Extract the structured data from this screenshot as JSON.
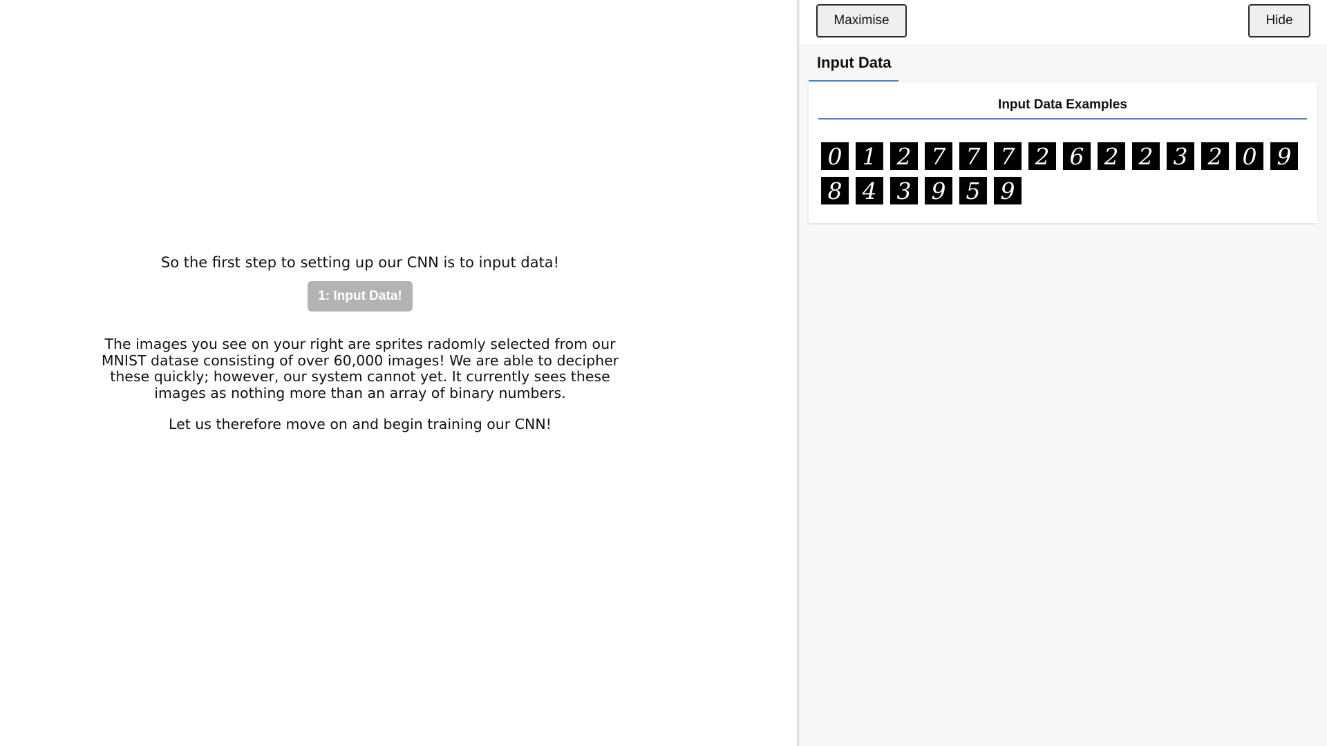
{
  "left": {
    "intro": "So the first step to setting up our CNN is to input data!",
    "step_button": "1: Input Data!",
    "description": "The images you see on your right are sprites radomly selected from our MNIST datase consisting of over 60,000 images! We are able to decipher these quickly; however, our system cannot yet. It currently sees these images as nothing more than an array of binary numbers.",
    "closing": "Let us therefore move on and begin training our CNN!"
  },
  "panel": {
    "maximise_label": "Maximise",
    "hide_label": "Hide",
    "tab_label": "Input Data",
    "card_title": "Input Data Examples",
    "digits": [
      "0",
      "1",
      "2",
      "7",
      "7",
      "7",
      "2",
      "6",
      "2",
      "2",
      "3",
      "2",
      "0",
      "9",
      "8",
      "4",
      "3",
      "9",
      "5",
      "9"
    ]
  },
  "colors": {
    "accent": "#4a7fd1",
    "button_disabled": "#b3b3b3",
    "panel_bg": "#f8f8f8"
  }
}
